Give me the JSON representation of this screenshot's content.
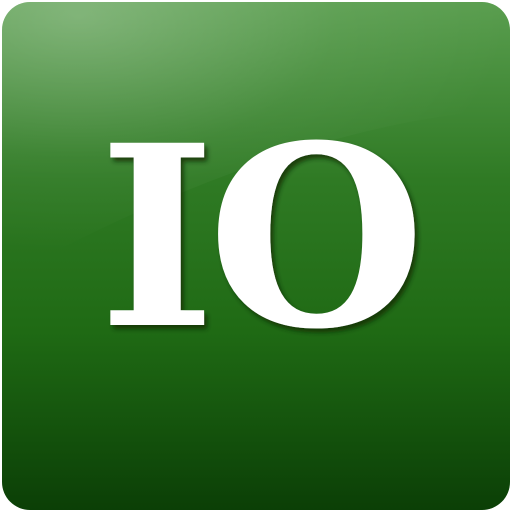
{
  "icon": {
    "logo_text": "IO",
    "colors": {
      "background_top": "#5a9e4f",
      "background_mid": "#1f6a14",
      "background_bottom": "#0b3f06",
      "letter_fill": "#ffffff",
      "letter_shadow": "#0a2a05"
    }
  }
}
